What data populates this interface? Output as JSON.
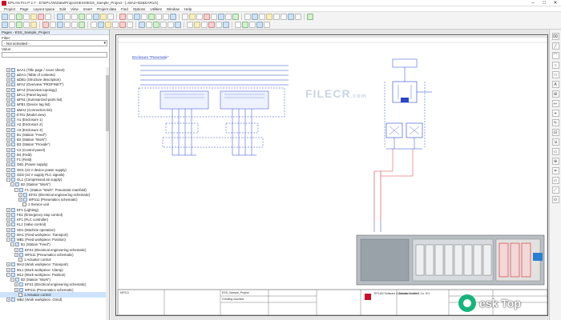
{
  "window": {
    "title": "EPLAN Pro P 2.7 - D:\\EPLAN\\Data\\Projects\\ESS\\ESS_Sample_Project - [=MA2+B2&EAR1/1]",
    "buttons": [
      "–",
      "□",
      "✕"
    ]
  },
  "menu": [
    "Project",
    "Page",
    "Layout space",
    "Edit",
    "View",
    "Insert",
    "Project data",
    "Find",
    "Options",
    "Utilities",
    "Window",
    "Help"
  ],
  "panel": {
    "title": "Pages - ESS_Sample_Project",
    "filter_label": "Filter:",
    "filter_value": "- Not activated -",
    "value_label": "Value:"
  },
  "tree": [
    {
      "indent": 1,
      "exp": "+",
      "icon": "folder",
      "label": "&AA1 (Title page / cover sheet)"
    },
    {
      "indent": 1,
      "exp": "+",
      "icon": "folder",
      "label": "&DA1 (Table of contents)"
    },
    {
      "indent": 1,
      "exp": "+",
      "icon": "folder",
      "label": "&DB1 (Structure description)"
    },
    {
      "indent": 1,
      "exp": "+",
      "icon": "folder",
      "label": "&FA2 (Overview \"PROFINET\")"
    },
    {
      "indent": 1,
      "exp": "+",
      "icon": "folder",
      "label": "&FA4 (Overview topology)"
    },
    {
      "indent": 1,
      "exp": "+",
      "icon": "folder",
      "label": "&FL1 (Panel layout)"
    },
    {
      "indent": 1,
      "exp": "+",
      "icon": "folder",
      "label": "&FN1 (Summarized parts list)"
    },
    {
      "indent": 1,
      "exp": "+",
      "icon": "folder",
      "label": "&FB1 (Device tag list)"
    },
    {
      "indent": 1,
      "exp": "+",
      "icon": "folder",
      "label": "&MA1 (Connection list)"
    },
    {
      "indent": 1,
      "exp": "+",
      "icon": "folder",
      "label": "ET01 (Model view)"
    },
    {
      "indent": 1,
      "exp": "+",
      "icon": "folder",
      "label": "A1 (Enclosure 1)"
    },
    {
      "indent": 1,
      "exp": "+",
      "icon": "folder",
      "label": "A2 (Enclosure 2)"
    },
    {
      "indent": 1,
      "exp": "+",
      "icon": "folder",
      "label": "A3 (Enclosure 3)"
    },
    {
      "indent": 1,
      "exp": "+",
      "icon": "folder",
      "label": "B1 (Station \"Feed\")"
    },
    {
      "indent": 1,
      "exp": "+",
      "icon": "folder",
      "label": "B2 (Station \"Work\")"
    },
    {
      "indent": 1,
      "exp": "+",
      "icon": "folder",
      "label": "B3 (Station \"Provide\")"
    },
    {
      "indent": 1,
      "exp": "+",
      "icon": "folder",
      "label": "C2 (Control panel)"
    },
    {
      "indent": 1,
      "exp": "+",
      "icon": "folder",
      "label": "B4 (Field)"
    },
    {
      "indent": 1,
      "exp": "+",
      "icon": "folder",
      "label": "F1 (Field)"
    },
    {
      "indent": 1,
      "exp": "+",
      "icon": "folder",
      "label": "GB1 (Power supply)"
    },
    {
      "indent": 1,
      "exp": "+",
      "icon": "folder",
      "label": "GD1 (24 V device power supply)"
    },
    {
      "indent": 1,
      "exp": "+",
      "icon": "folder",
      "label": "GD2 (24 V supply PLC signals)"
    },
    {
      "indent": 1,
      "exp": "−",
      "icon": "folder",
      "label": "GL1 (Compressed air supply)"
    },
    {
      "indent": 2,
      "exp": "−",
      "icon": "folder",
      "label": "B2 (Station \"Work\")"
    },
    {
      "indent": 3,
      "exp": "−",
      "icon": "folder",
      "label": "F1 (Station \"Work\": Pneumatic manifold)"
    },
    {
      "indent": 4,
      "exp": "+",
      "icon": "folder",
      "label": "EFS1 (Electrical engineering schematic)"
    },
    {
      "indent": 4,
      "exp": "+",
      "icon": "folder",
      "label": "MFS11 (Pneumatics schematic)"
    },
    {
      "indent": 5,
      "exp": "",
      "icon": "page",
      "label": "1 Service unit"
    },
    {
      "indent": 1,
      "exp": "+",
      "icon": "folder",
      "label": "EF1 (Lighting)"
    },
    {
      "indent": 1,
      "exp": "+",
      "icon": "folder",
      "label": "FE1 (Emergency stop control)"
    },
    {
      "indent": 1,
      "exp": "+",
      "icon": "folder",
      "label": "KF1 (PLC controller)"
    },
    {
      "indent": 1,
      "exp": "+",
      "icon": "folder",
      "label": "KL1 (Valve control)"
    },
    {
      "indent": 1,
      "exp": "+",
      "icon": "folder",
      "label": "SD1 (Machine operation)"
    },
    {
      "indent": 1,
      "exp": "+",
      "icon": "folder",
      "label": "MA1 (Feed workpiece: Transport)"
    },
    {
      "indent": 1,
      "exp": "−",
      "icon": "folder",
      "label": "MB1 (Feed workpiece: Position)"
    },
    {
      "indent": 2,
      "exp": "−",
      "icon": "folder",
      "label": "B1 (Station \"Feed\")"
    },
    {
      "indent": 3,
      "exp": "+",
      "icon": "folder",
      "label": "EFS1 (Electrical engineering schematic)"
    },
    {
      "indent": 3,
      "exp": "+",
      "icon": "folder",
      "label": "MFS11 (Pneumatics schematic)"
    },
    {
      "indent": 4,
      "exp": "",
      "icon": "page",
      "label": "1 Actuator control"
    },
    {
      "indent": 1,
      "exp": "+",
      "icon": "folder",
      "label": "MA2 (Work workpiece: Transport)"
    },
    {
      "indent": 1,
      "exp": "+",
      "icon": "folder",
      "label": "ML1 (Work workpiece: Clamp)"
    },
    {
      "indent": 1,
      "exp": "−",
      "icon": "folder",
      "label": "ML2 (Work workpiece: Position)"
    },
    {
      "indent": 2,
      "exp": "−",
      "icon": "folder",
      "label": "B2 (Station \"Work\")"
    },
    {
      "indent": 3,
      "exp": "+",
      "icon": "folder",
      "label": "EFS1 (Electrical engineering schematic)"
    },
    {
      "indent": 3,
      "exp": "+",
      "icon": "folder",
      "label": "MFS11 (Pneumatics schematic)"
    },
    {
      "indent": 4,
      "exp": "",
      "icon": "page",
      "label": "1 Actuator control",
      "selected": true
    },
    {
      "indent": 1,
      "exp": "+",
      "icon": "folder",
      "label": "MB2 (Work workpiece: Grind)"
    }
  ],
  "drawing": {
    "enclosure_label": "Enclosure \"Pneumatic\"",
    "watermark": "FILECR",
    "watermark_sub": ".com",
    "title_block": {
      "project": "ESS_Sample_Project",
      "description": "Grinding machine",
      "company": "EPLAN Software & Service GmbH & Co. KG",
      "page_name": "Actuator control",
      "sheet_id": "MFS11"
    }
  },
  "brand": {
    "name": "esk Top"
  },
  "colors": {
    "accent": "#c8102e",
    "wire_blue": "#2b46c9",
    "wire_red": "#d23a3a",
    "selection": "#cde3fb"
  }
}
